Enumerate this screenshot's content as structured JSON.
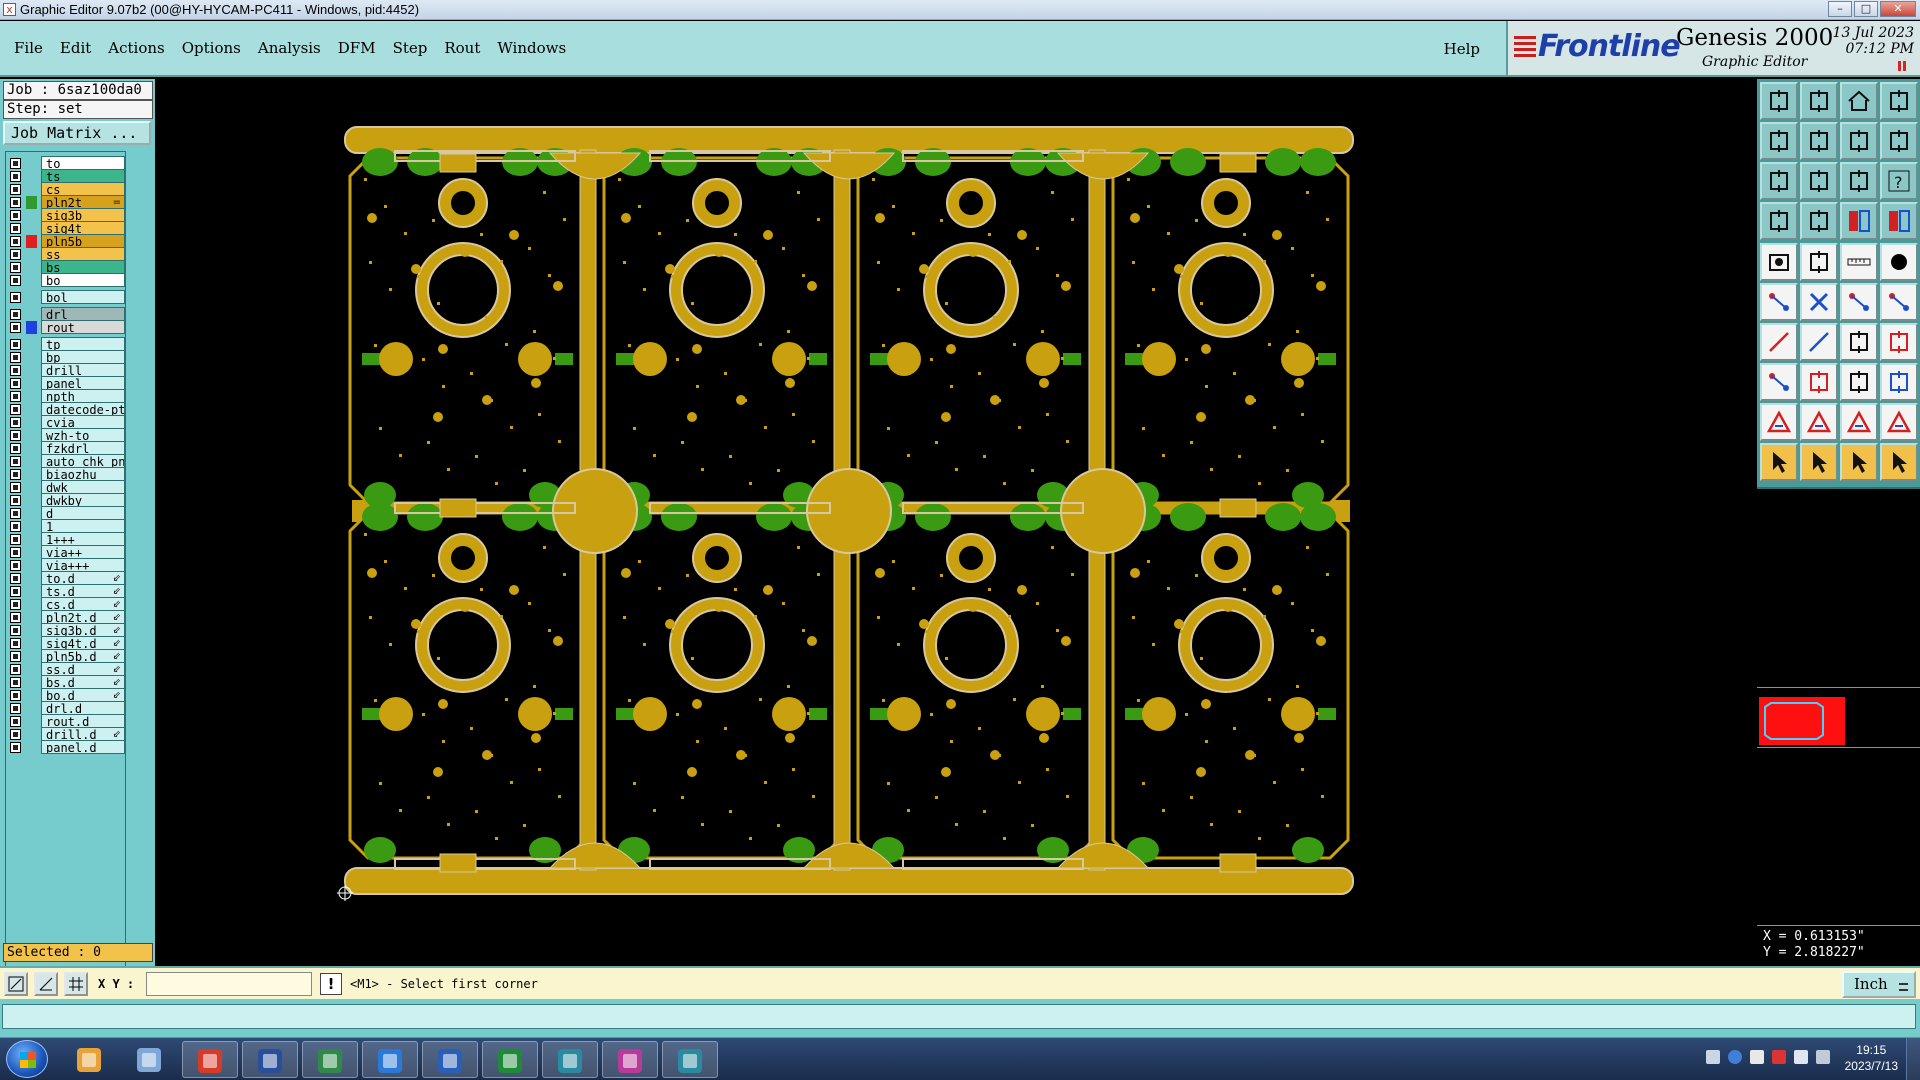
{
  "window": {
    "title": "Graphic Editor 9.07b2 (00@HY-HYCAM-PC411 - Windows, pid:4452)",
    "icon": "x-app-icon",
    "controls": [
      "minimize",
      "maximize",
      "close"
    ]
  },
  "menu": {
    "items": [
      "File",
      "Edit",
      "Actions",
      "Options",
      "Analysis",
      "DFM",
      "Step",
      "Rout",
      "Windows"
    ],
    "help": "Help"
  },
  "brand": {
    "logo": "Frontline",
    "product": "Genesis 2000",
    "subtitle": "Graphic Editor",
    "date_line1": "13 Jul 2023",
    "date_line2": "07:12 PM"
  },
  "job": {
    "job_line": "Job : 6saz100da0",
    "step_line": "Step: set",
    "matrix_button": "Job Matrix ..."
  },
  "layers": [
    {
      "name": "to",
      "color": "#ffffff",
      "swatch": ""
    },
    {
      "name": "ts",
      "color": "#3cb48c",
      "swatch": ""
    },
    {
      "name": "cs",
      "color": "#f2c24a",
      "swatch": ""
    },
    {
      "name": "pln2t",
      "color": "#d6a21e",
      "swatch": "#2f9a2f",
      "flag": "="
    },
    {
      "name": "sig3b",
      "color": "#f2c24a",
      "swatch": ""
    },
    {
      "name": "sig4t",
      "color": "#f2c24a",
      "swatch": ""
    },
    {
      "name": "pln5b",
      "color": "#d6a21e",
      "swatch": "#e02020"
    },
    {
      "name": "ss",
      "color": "#f2c24a",
      "swatch": ""
    },
    {
      "name": "bs",
      "color": "#3cb48c",
      "swatch": ""
    },
    {
      "name": "bo",
      "color": "#ffffff",
      "swatch": ""
    },
    {
      "name": "bol",
      "color": "#cdf0f0",
      "swatch": "",
      "gap": true
    },
    {
      "name": "drl",
      "color": "#9fb7b7",
      "swatch": "",
      "gap": true
    },
    {
      "name": "rout",
      "color": "#d9d9d9",
      "swatch": "#2040e0"
    },
    {
      "name": "tp",
      "color": "#cdf0f0",
      "swatch": "",
      "gap": true
    },
    {
      "name": "bp",
      "color": "#cdf0f0",
      "swatch": ""
    },
    {
      "name": "drill",
      "color": "#cdf0f0",
      "swatch": ""
    },
    {
      "name": "panel",
      "color": "#cdf0f0",
      "swatch": ""
    },
    {
      "name": "npth",
      "color": "#cdf0f0",
      "swatch": ""
    },
    {
      "name": "datecode-pt",
      "color": "#cdf0f0",
      "swatch": ""
    },
    {
      "name": "cvia",
      "color": "#cdf0f0",
      "swatch": ""
    },
    {
      "name": "wzh-to",
      "color": "#cdf0f0",
      "swatch": ""
    },
    {
      "name": "fzkdrl",
      "color": "#cdf0f0",
      "swatch": ""
    },
    {
      "name": "auto_chk_pn",
      "color": "#cdf0f0",
      "swatch": ""
    },
    {
      "name": "biaozhu",
      "color": "#cdf0f0",
      "swatch": ""
    },
    {
      "name": "dwk",
      "color": "#cdf0f0",
      "swatch": ""
    },
    {
      "name": "dwkby",
      "color": "#cdf0f0",
      "swatch": ""
    },
    {
      "name": "d",
      "color": "#cdf0f0",
      "swatch": ""
    },
    {
      "name": "1",
      "color": "#cdf0f0",
      "swatch": ""
    },
    {
      "name": "1+++",
      "color": "#cdf0f0",
      "swatch": ""
    },
    {
      "name": "via++",
      "color": "#cdf0f0",
      "swatch": ""
    },
    {
      "name": "via+++",
      "color": "#cdf0f0",
      "swatch": ""
    },
    {
      "name": "to.d",
      "color": "#cdf0f0",
      "swatch": "",
      "flag": "⇙"
    },
    {
      "name": "ts.d",
      "color": "#cdf0f0",
      "swatch": "",
      "flag": "⇙"
    },
    {
      "name": "cs.d",
      "color": "#cdf0f0",
      "swatch": "",
      "flag": "⇙"
    },
    {
      "name": "pln2t.d",
      "color": "#cdf0f0",
      "swatch": "",
      "flag": "⇙"
    },
    {
      "name": "sig3b.d",
      "color": "#cdf0f0",
      "swatch": "",
      "flag": "⇙"
    },
    {
      "name": "sig4t.d",
      "color": "#cdf0f0",
      "swatch": "",
      "flag": "⇙"
    },
    {
      "name": "pln5b.d",
      "color": "#cdf0f0",
      "swatch": "",
      "flag": "⇙"
    },
    {
      "name": "ss.d",
      "color": "#cdf0f0",
      "swatch": "",
      "flag": "⇙"
    },
    {
      "name": "bs.d",
      "color": "#cdf0f0",
      "swatch": "",
      "flag": "⇙"
    },
    {
      "name": "bo.d",
      "color": "#cdf0f0",
      "swatch": "",
      "flag": "⇙"
    },
    {
      "name": "drl.d",
      "color": "#cdf0f0",
      "swatch": ""
    },
    {
      "name": "rout.d",
      "color": "#cdf0f0",
      "swatch": ""
    },
    {
      "name": "drill.d",
      "color": "#cdf0f0",
      "swatch": "",
      "flag": "⇙"
    },
    {
      "name": "panel.d",
      "color": "#cdf0f0",
      "swatch": ""
    }
  ],
  "selected": "Selected : 0",
  "coords": {
    "x_line": "X = 0.613153\"",
    "y_line": "Y = 2.818227\""
  },
  "command": {
    "xy_label": "X Y :",
    "xy_value": "",
    "prompt": "<M1> - Select first corner",
    "units": "Inch"
  },
  "colors": {
    "copper": "#c9a010",
    "copper_edge": "#d8c8a0",
    "soldermask": "#3a9a12",
    "background": "#000000",
    "teal": "#76cccc"
  },
  "taskbar": {
    "apps": [
      "shell-icon",
      "notepad-icon",
      "chrome-like-icon",
      "save-disk-icon",
      "p-app-icon",
      "arrow-app-icon",
      "word-icon",
      "excel-icon",
      "eye-app-icon",
      "x-app-icon",
      "eye-app-icon-2"
    ],
    "clock_time": "19:15",
    "clock_date": "2023/7/13"
  }
}
